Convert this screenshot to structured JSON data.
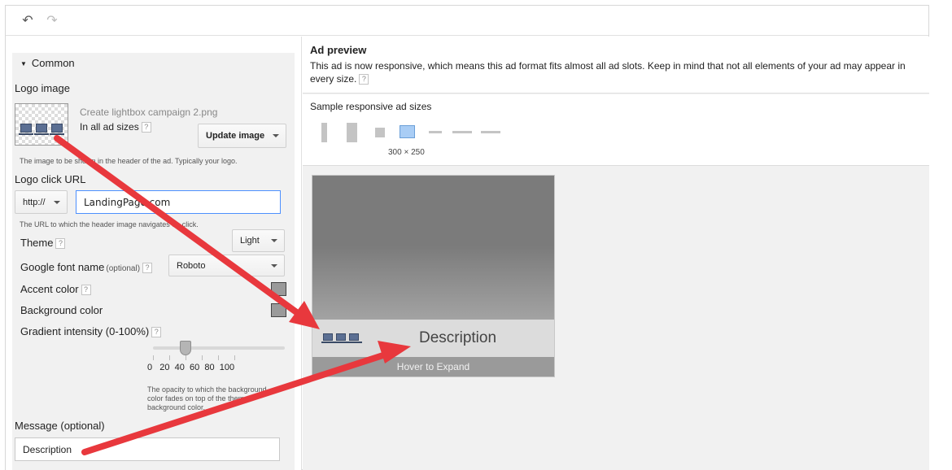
{
  "toolbar": {
    "undo_icon": "undo-icon",
    "redo_icon": "redo-icon"
  },
  "form": {
    "section_title": "Common",
    "logo_label": "Logo image",
    "logo_filename": "Create lightbox campaign 2.png",
    "logo_sizes": "In all ad sizes",
    "update_button": "Update image",
    "logo_hint": "The image to be shown in the header of the ad. Typically your logo.",
    "logo_url_label": "Logo click URL",
    "protocol": "http://",
    "url_value": "LandingPage.com",
    "url_hint": "The URL to which the header image navigates on click.",
    "theme_label": "Theme",
    "theme_value": "Light",
    "font_label": "Google font name",
    "font_optional": "(optional)",
    "font_value": "Roboto",
    "accent_label": "Accent color",
    "background_label": "Background color",
    "gradient_label": "Gradient intensity (0-100%)",
    "slider_ticks": [
      "0",
      "20",
      "40",
      "60",
      "80",
      "100"
    ],
    "slider_value": 40,
    "gradient_hint": "The opacity to which the background color fades on top of the theme background color.",
    "message_label": "Message (optional)",
    "message_value": "Description",
    "help": "?"
  },
  "preview": {
    "title": "Ad preview",
    "desc": "This ad is now responsive, which means this ad format fits almost all ad slots. Keep in mind that not all elements of your ad may appear in every size.",
    "sizes_label": "Sample responsive ad sizes",
    "selected_size": "300 × 250",
    "ad_description": "Description",
    "ad_footer": "Hover to Expand"
  },
  "colors": {
    "annotation_arrow": "#e8383d",
    "accent": "#4d90fe"
  }
}
